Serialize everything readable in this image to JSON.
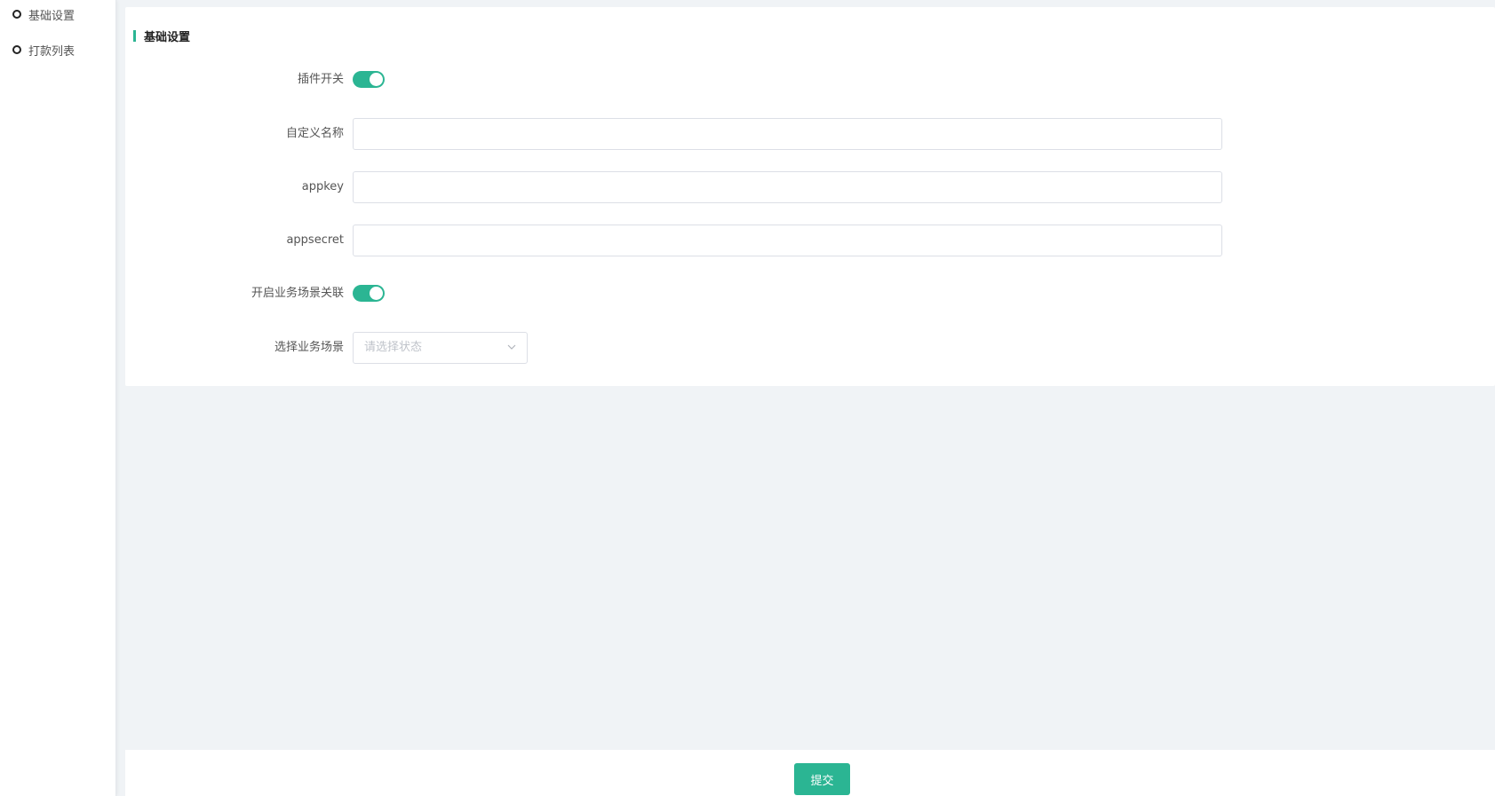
{
  "sidebar": {
    "items": [
      {
        "label": "基础设置"
      },
      {
        "label": "打款列表"
      }
    ]
  },
  "panel": {
    "title": "基础设置",
    "fields": {
      "plugin_switch": {
        "label": "插件开关",
        "on": true
      },
      "custom_name": {
        "label": "自定义名称",
        "value": ""
      },
      "appkey": {
        "label": "appkey",
        "value": ""
      },
      "appsecret": {
        "label": "appsecret",
        "value": ""
      },
      "scene_link": {
        "label": "开启业务场景关联",
        "on": true
      },
      "scene_select": {
        "label": "选择业务场景",
        "placeholder": "请选择状态"
      }
    }
  },
  "footer": {
    "submit_label": "提交"
  },
  "colors": {
    "accent": "#2bb593",
    "background": "#f0f3f6"
  }
}
